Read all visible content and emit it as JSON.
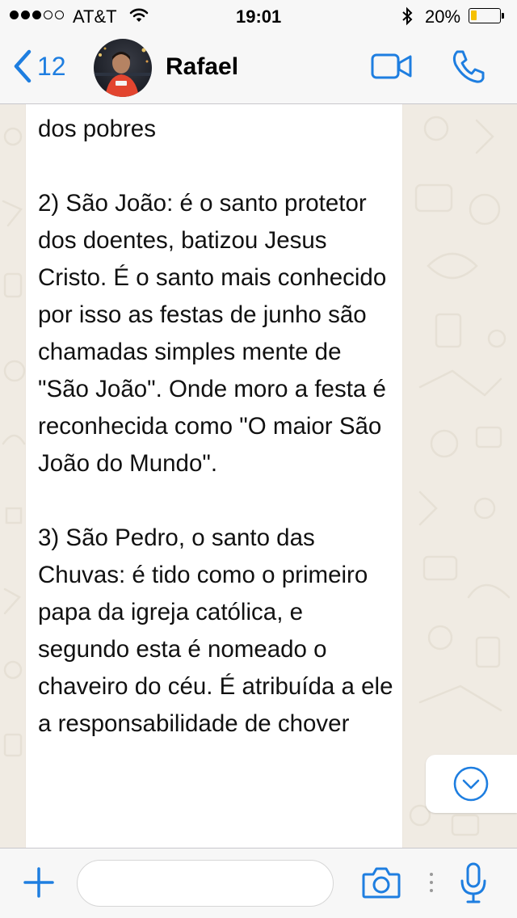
{
  "status_bar": {
    "carrier": "AT&T",
    "time": "19:01",
    "battery_percent": "20%",
    "battery_level": 0.2,
    "signal_bars_filled": 3,
    "signal_bars_total": 5
  },
  "nav": {
    "back_count": "12",
    "contact_name": "Rafael"
  },
  "message": {
    "text": "dos pobres\n\n2) São João: é o santo protetor dos doentes, batizou Jesus Cristo. É o santo mais conhecido por isso as festas de junho são chamadas simples mente de \"São João\". Onde moro a festa é reconhecida como \"O maior São João do Mundo\".\n\n3) São Pedro, o santo das Chuvas: é tido como o primeiro papa da igreja católica, e segundo esta é nomeado o chaveiro do céu. É atribuída a ele a responsabilidade de chover"
  },
  "input": {
    "placeholder": "",
    "value": ""
  },
  "colors": {
    "accent": "#1e7ee0",
    "chat_background": "#f0ebe3",
    "bubble": "#ffffff",
    "battery_fill": "#f5c000"
  },
  "icons": {
    "back": "chevron-left-icon",
    "video": "video-camera-icon",
    "call": "phone-icon",
    "scroll_down": "chevron-down-circle-icon",
    "attach": "plus-icon",
    "camera": "camera-icon",
    "more": "vertical-dots-icon",
    "mic": "microphone-icon",
    "wifi": "wifi-icon",
    "bluetooth": "bluetooth-icon",
    "battery": "battery-icon"
  }
}
